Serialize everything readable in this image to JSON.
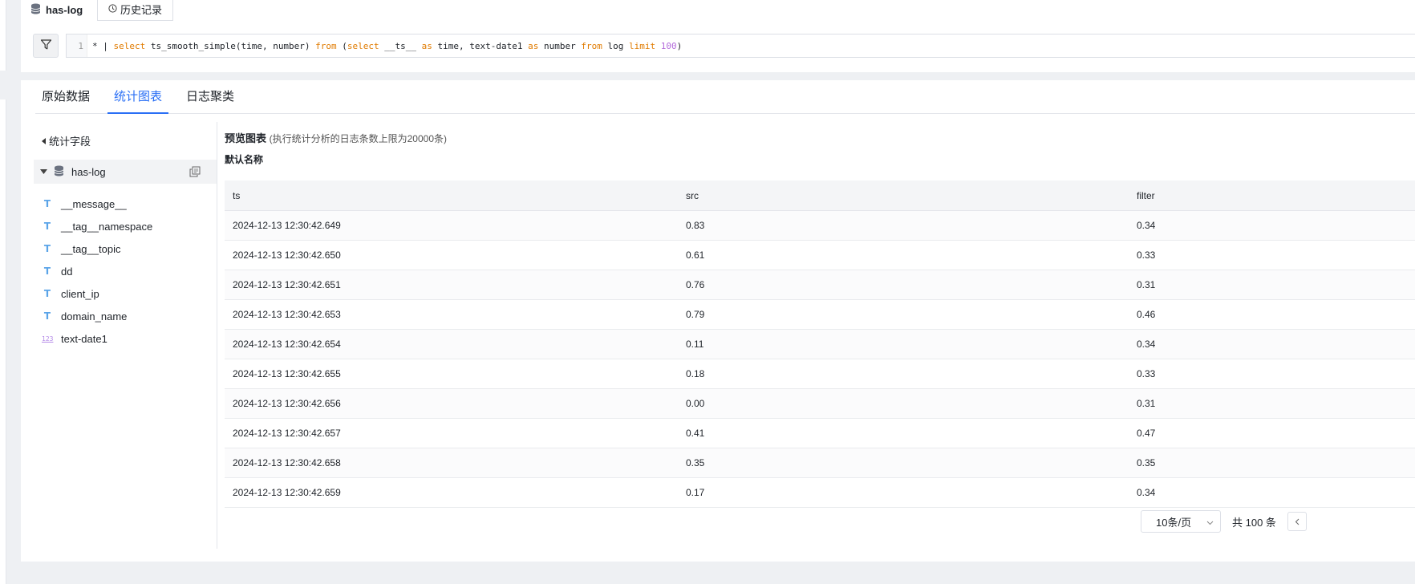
{
  "header": {
    "log_tab_label": "has-log",
    "history_button_label": "历史记录"
  },
  "query": {
    "line_number": "1",
    "tokens": [
      {
        "t": "* | ",
        "k": "plain"
      },
      {
        "t": "select",
        "k": "kw"
      },
      {
        "t": " ts_smooth_simple(time, number) ",
        "k": "plain"
      },
      {
        "t": "from",
        "k": "kw"
      },
      {
        "t": " (",
        "k": "plain"
      },
      {
        "t": "select",
        "k": "kw"
      },
      {
        "t": " __ts__ ",
        "k": "plain"
      },
      {
        "t": "as",
        "k": "kw"
      },
      {
        "t": " time, text-date1 ",
        "k": "plain"
      },
      {
        "t": "as",
        "k": "kw"
      },
      {
        "t": " number ",
        "k": "plain"
      },
      {
        "t": "from",
        "k": "kw"
      },
      {
        "t": " log ",
        "k": "plain"
      },
      {
        "t": "limit",
        "k": "kw"
      },
      {
        "t": " 100",
        "k": "num"
      },
      {
        "t": ")",
        "k": "plain"
      }
    ]
  },
  "tabs": {
    "raw": "原始数据",
    "stats": "统计图表",
    "cluster": "日志聚类"
  },
  "sidebar": {
    "heading": "统计字段",
    "logstore": "has-log",
    "fields": [
      {
        "name": "__message__",
        "type": "text"
      },
      {
        "name": "__tag__namespace",
        "type": "text"
      },
      {
        "name": "__tag__topic",
        "type": "text"
      },
      {
        "name": "dd",
        "type": "text"
      },
      {
        "name": "client_ip",
        "type": "text"
      },
      {
        "name": "domain_name",
        "type": "text"
      },
      {
        "name": "text-date1",
        "type": "number"
      }
    ],
    "text_icon": "T",
    "number_icon": "123"
  },
  "preview": {
    "title": "预览图表",
    "note": "(执行统计分析的日志条数上限为20000条)",
    "chart_name": "默认名称"
  },
  "table": {
    "columns": [
      "ts",
      "src",
      "filter"
    ],
    "rows": [
      [
        "2024-12-13 12:30:42.649",
        "0.83",
        "0.34"
      ],
      [
        "2024-12-13 12:30:42.650",
        "0.61",
        "0.33"
      ],
      [
        "2024-12-13 12:30:42.651",
        "0.76",
        "0.31"
      ],
      [
        "2024-12-13 12:30:42.653",
        "0.79",
        "0.46"
      ],
      [
        "2024-12-13 12:30:42.654",
        "0.11",
        "0.34"
      ],
      [
        "2024-12-13 12:30:42.655",
        "0.18",
        "0.33"
      ],
      [
        "2024-12-13 12:30:42.656",
        "0.00",
        "0.31"
      ],
      [
        "2024-12-13 12:30:42.657",
        "0.41",
        "0.47"
      ],
      [
        "2024-12-13 12:30:42.658",
        "0.35",
        "0.35"
      ],
      [
        "2024-12-13 12:30:42.659",
        "0.17",
        "0.34"
      ]
    ]
  },
  "pagination": {
    "page_size": "10条/页",
    "total": "共 100 条"
  },
  "colors": {
    "accent": "#2a6ff5",
    "keyword": "#e07b00",
    "number": "#b46cdb"
  }
}
